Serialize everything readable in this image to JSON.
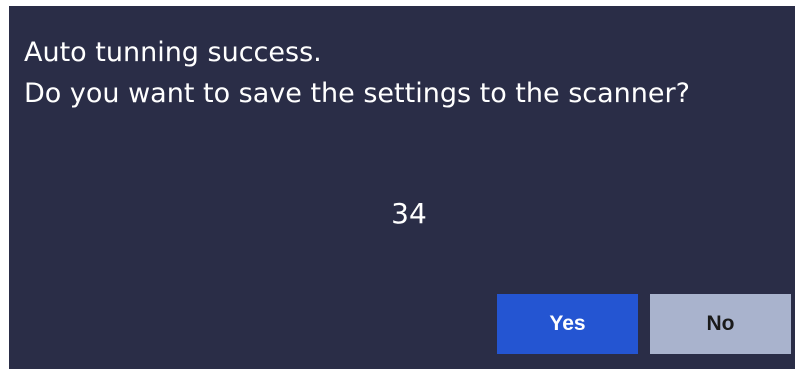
{
  "dialog": {
    "line1": "Auto tunning success.",
    "line2": "Do you want to save the settings to the scanner?",
    "value": "34",
    "yes_label": "Yes",
    "no_label": "No"
  },
  "colors": {
    "background": "#2a2d47",
    "yes_button": "#2455d2",
    "no_button": "#a9b3cd"
  }
}
